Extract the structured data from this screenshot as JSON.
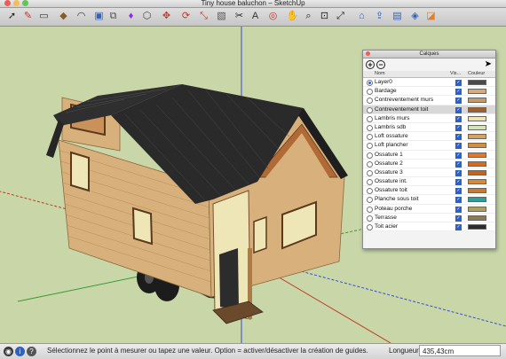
{
  "window": {
    "title": "Tiny house baluchon – SketchUp"
  },
  "toolbar": {
    "tools": [
      {
        "name": "select-tool-icon",
        "glyph": "➚",
        "color": "#222"
      },
      {
        "name": "pencil-tool-icon",
        "glyph": "✎",
        "color": "#c0392b"
      },
      {
        "name": "rectangle-tool-icon",
        "glyph": "▭",
        "color": "#333"
      },
      {
        "name": "paint-bucket-icon",
        "glyph": "◆",
        "color": "#8b5a2b"
      },
      {
        "name": "arc-tool-icon",
        "glyph": "◠",
        "color": "#333"
      },
      {
        "name": "push-pull-icon",
        "glyph": "▣",
        "color": "#2d62c5"
      },
      {
        "name": "group-icon",
        "glyph": "⧉",
        "color": "#555"
      },
      {
        "name": "materials-icon",
        "glyph": "♦",
        "color": "#8a2be2"
      },
      {
        "name": "components-icon",
        "glyph": "⬡",
        "color": "#444"
      },
      {
        "name": "move-tool-icon",
        "glyph": "✥",
        "color": "#c0392b"
      },
      {
        "name": "rotate-tool-icon",
        "glyph": "⟳",
        "color": "#c0392b"
      },
      {
        "name": "scale-tool-icon",
        "glyph": "⤡",
        "color": "#c0392b"
      },
      {
        "name": "offset-tool-icon",
        "glyph": "▧",
        "color": "#555"
      },
      {
        "name": "tape-measure-icon",
        "glyph": "✂",
        "color": "#222"
      },
      {
        "name": "text-tool-icon",
        "glyph": "A",
        "color": "#333"
      },
      {
        "name": "orbit-tool-icon",
        "glyph": "◎",
        "color": "#c0392b"
      },
      {
        "name": "pan-tool-icon",
        "glyph": "✋",
        "color": "#222"
      },
      {
        "name": "zoom-tool-icon",
        "glyph": "⌕",
        "color": "#222"
      },
      {
        "name": "zoom-window-icon",
        "glyph": "⊡",
        "color": "#222"
      },
      {
        "name": "zoom-extents-icon",
        "glyph": "⤢",
        "color": "#222"
      },
      {
        "name": "warehouse-icon",
        "glyph": "⌂",
        "color": "#2d62c5"
      },
      {
        "name": "share-model-icon",
        "glyph": "⇪",
        "color": "#2d62c5"
      },
      {
        "name": "extension-icon",
        "glyph": "▤",
        "color": "#2d62c5"
      },
      {
        "name": "layout-icon",
        "glyph": "◈",
        "color": "#2d62c5"
      },
      {
        "name": "style-builder-icon",
        "glyph": "◪",
        "color": "#e67e22"
      }
    ]
  },
  "layers_panel": {
    "title": "Calques",
    "headers": {
      "name": "Nom",
      "visible": "Vis...",
      "color": "Couleur"
    },
    "layers": [
      {
        "name": "Layer0",
        "active": true,
        "selected": false,
        "color": "#4a4a4a"
      },
      {
        "name": "Bardage",
        "active": false,
        "selected": false,
        "color": "#d9a978"
      },
      {
        "name": "Contreventement murs",
        "active": false,
        "selected": false,
        "color": "#c69a6a"
      },
      {
        "name": "Contreventement toit",
        "active": false,
        "selected": true,
        "color": "#a05e2c"
      },
      {
        "name": "Lambris murs",
        "active": false,
        "selected": false,
        "color": "#efe3b2"
      },
      {
        "name": "Lambris sdb",
        "active": false,
        "selected": false,
        "color": "#d5e4b4"
      },
      {
        "name": "Loft ossature",
        "active": false,
        "selected": false,
        "color": "#d9a15e"
      },
      {
        "name": "Loft plancher",
        "active": false,
        "selected": false,
        "color": "#d48f3a"
      },
      {
        "name": "Ossature 1",
        "active": false,
        "selected": false,
        "color": "#e07a2a"
      },
      {
        "name": "Ossature 2",
        "active": false,
        "selected": false,
        "color": "#d66a1e"
      },
      {
        "name": "Ossature 3",
        "active": false,
        "selected": false,
        "color": "#c9621a"
      },
      {
        "name": "Ossature int.",
        "active": false,
        "selected": false,
        "color": "#d88a3a"
      },
      {
        "name": "Ossature toit",
        "active": false,
        "selected": false,
        "color": "#c97a30"
      },
      {
        "name": "Planche sous toit",
        "active": false,
        "selected": false,
        "color": "#2aa197"
      },
      {
        "name": "Poteau porche",
        "active": false,
        "selected": false,
        "color": "#b0a060"
      },
      {
        "name": "Terrasse",
        "active": false,
        "selected": false,
        "color": "#8a7a55"
      },
      {
        "name": "Toit acier",
        "active": false,
        "selected": false,
        "color": "#2c2c2c"
      }
    ]
  },
  "status": {
    "message": "Sélectionnez le point à mesurer ou tapez une valeur.  Option = activer/désactiver la création de guides.",
    "length_label": "Longueur",
    "length_value": "435,43cm"
  },
  "colors": {
    "ground": "#c8d6a8",
    "sky": "#e6eef0",
    "roof": "#2a2a2a",
    "wood_siding": "#d9b07a",
    "axis_blue": "#3b4bd8",
    "axis_green": "#3a9a3a",
    "axis_red": "#c0392b"
  }
}
